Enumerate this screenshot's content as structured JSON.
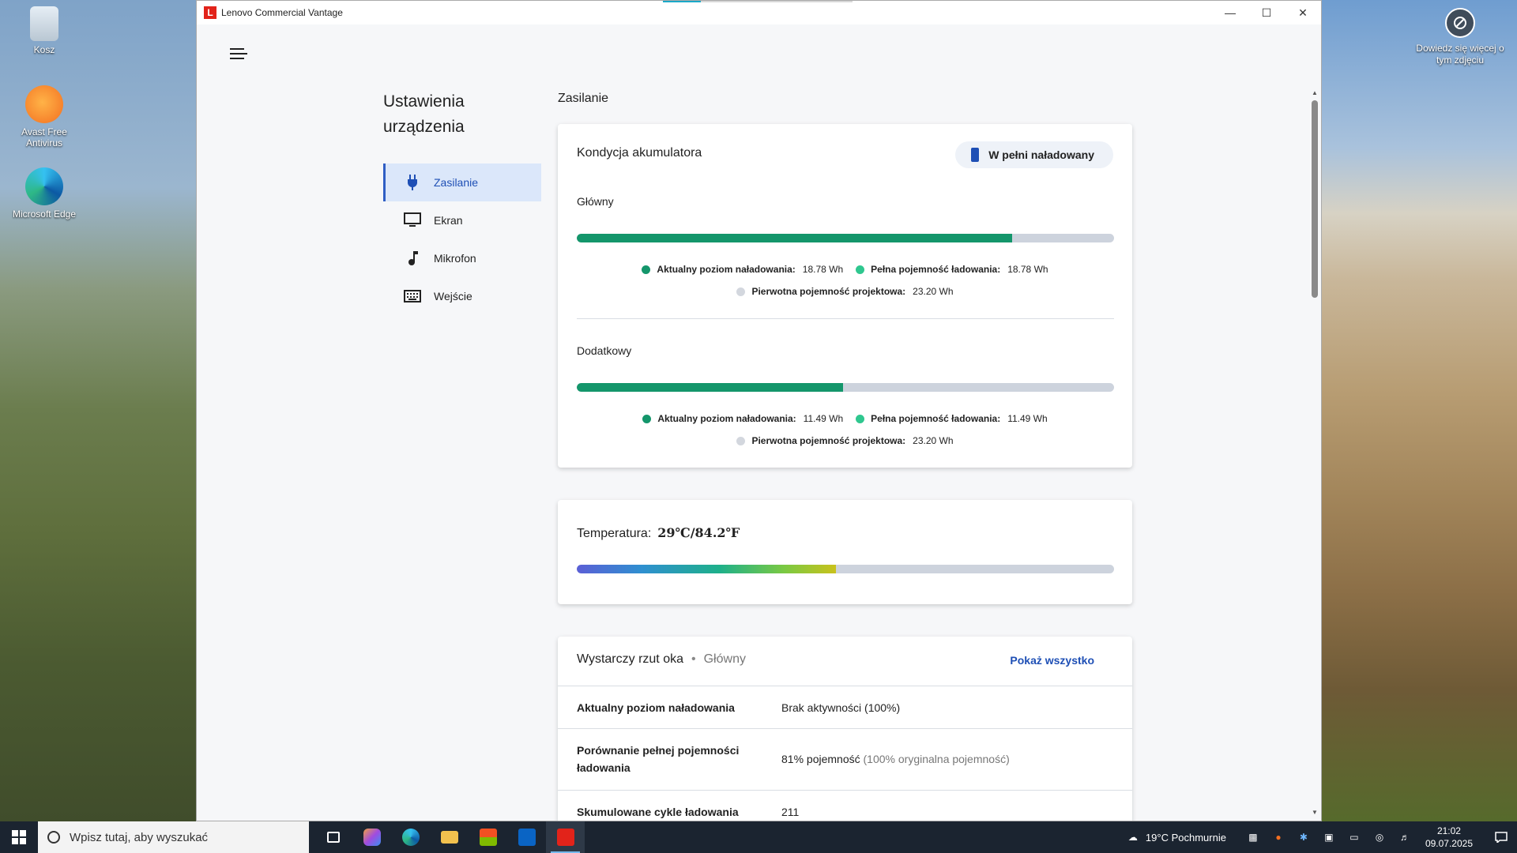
{
  "desktop": {
    "icons": [
      {
        "label": "Kosz",
        "icon": "recycle-bin-icon"
      },
      {
        "label": "Avast Free Antivirus",
        "icon": "avast-icon"
      },
      {
        "label": "Microsoft Edge",
        "icon": "edge-icon"
      }
    ],
    "learn_more": "Dowiedz się więcej o tym zdjęciu"
  },
  "window": {
    "title": "Lenovo Commercial Vantage",
    "logo_letter": "L"
  },
  "sidebar": {
    "title": "Ustawienia urządzenia",
    "items": [
      {
        "label": "Zasilanie",
        "icon": "plug-icon",
        "active": true
      },
      {
        "label": "Ekran",
        "icon": "monitor-icon",
        "active": false
      },
      {
        "label": "Mikrofon",
        "icon": "music-note-icon",
        "active": false
      },
      {
        "label": "Wejście",
        "icon": "keyboard-icon",
        "active": false
      }
    ]
  },
  "main": {
    "section_title": "Zasilanie",
    "battery_card": {
      "title": "Kondycja akumulatora",
      "status_badge": "W pełni naładowany",
      "batteries": [
        {
          "name": "Główny",
          "fill_fraction": 0.81,
          "current_label": "Aktualny poziom naładowania:",
          "current_value": "18.78 Wh",
          "full_label": "Pełna pojemność ładowania:",
          "full_value": "18.78 Wh",
          "design_label": "Pierwotna pojemność projektowa:",
          "design_value": "23.20 Wh"
        },
        {
          "name": "Dodatkowy",
          "fill_fraction": 0.495,
          "current_label": "Aktualny poziom naładowania:",
          "current_value": "11.49 Wh",
          "full_label": "Pełna pojemność ładowania:",
          "full_value": "11.49 Wh",
          "design_label": "Pierwotna pojemność projektowa:",
          "design_value": "23.20 Wh"
        }
      ]
    },
    "temperature_card": {
      "label": "Temperatura:",
      "value": "29℃/84.2℉",
      "fill_fraction": 0.483
    },
    "glance_card": {
      "title": "Wystarczy rzut oka",
      "separator": "•",
      "subtitle": "Główny",
      "show_all": "Pokaż wszystko",
      "rows": [
        {
          "key": "Aktualny poziom naładowania",
          "value": "Brak aktywności (100%)",
          "muted": ""
        },
        {
          "key": "Porównanie pełnej pojemności ładowania",
          "value": "81% pojemność",
          "muted": "(100% oryginalna pojemność)"
        },
        {
          "key": "Skumulowane cykle ładowania",
          "value": "211",
          "muted": ""
        }
      ]
    }
  },
  "taskbar": {
    "search_placeholder": "Wpisz tutaj, aby wyszukać",
    "weather": "19°C  Pochmurnie",
    "time": "21:02",
    "date": "09.07.2025"
  },
  "colors": {
    "accent": "#1e4fb5",
    "battery_green": "#14966b",
    "track": "#cdd3dd",
    "active_nav_bg": "#dbe7fa"
  }
}
